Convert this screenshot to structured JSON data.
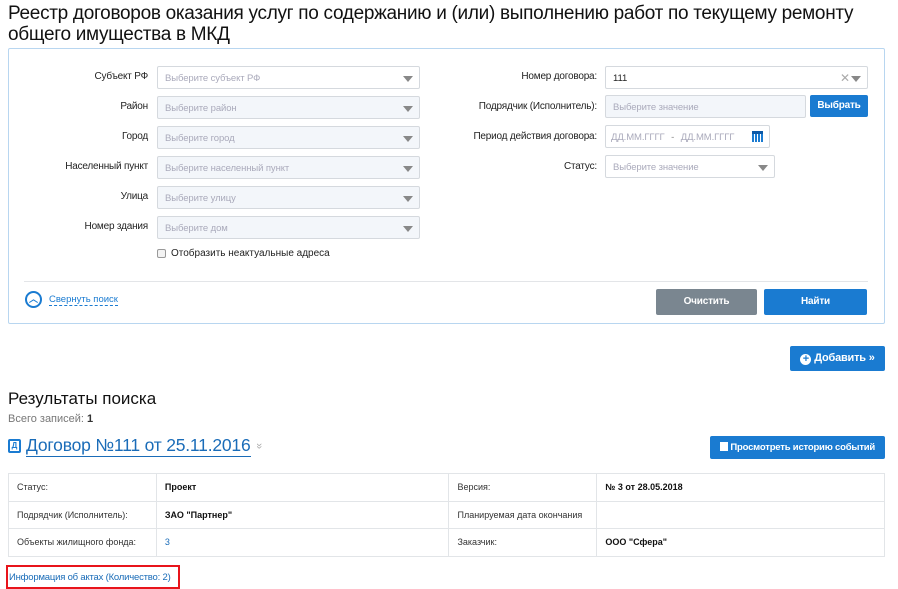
{
  "page_title": "Реестр договоров оказания услуг по содержанию и (или) выполнению работ по текущему ремонту общего имущества в МКД",
  "search": {
    "left_fields": [
      {
        "label": "Субъект РФ",
        "placeholder": "Выберите субъект РФ"
      },
      {
        "label": "Район",
        "placeholder": "Выберите район"
      },
      {
        "label": "Город",
        "placeholder": "Выберите город"
      },
      {
        "label": "Населенный пункт",
        "placeholder": "Выберите населенный пункт"
      },
      {
        "label": "Улица",
        "placeholder": "Выберите улицу"
      },
      {
        "label": "Номер здания",
        "placeholder": "Выберите дом"
      }
    ],
    "show_inactive_label": "Отобразить неактуальные адреса",
    "contract_number_label": "Номер договора:",
    "contract_number_value": "111",
    "contractor_label": "Подрядчик (Исполнитель):",
    "contractor_placeholder": "Выберите значение",
    "select_button": "Выбрать",
    "period_label": "Период действия договора:",
    "period_from_placeholder": "ДД.ММ.ГГГГ",
    "period_to_placeholder": "ДД.ММ.ГГГГ",
    "period_separator": "-",
    "status_label": "Статус:",
    "status_placeholder": "Выберите значение",
    "collapse_label": "Свернуть поиск",
    "clear_button": "Очистить",
    "find_button": "Найти"
  },
  "add_button": "Добавить",
  "results": {
    "title": "Результаты поиска",
    "total_label": "Всего записей:",
    "total_value": "1",
    "contract_title": "Договор №111 от 25.11.2016",
    "history_button": "Просмотреть историю событий",
    "rows": [
      [
        "Статус:",
        "Проект",
        "Версия:",
        "№ 3 от 28.05.2018"
      ],
      [
        "Подрядчик (Исполнитель):",
        "ЗАО \"Партнер\"",
        "Планируемая дата окончания",
        ""
      ],
      [
        "Объекты жилищного фонда:",
        "3",
        "Заказчик:",
        "ООО \"Сфера\""
      ]
    ],
    "acts_link": "Информация об актах (Количество: 2)"
  },
  "colors": {
    "accent": "#1a7bd1",
    "grey_button": "#7a8690",
    "highlight": "#e8141b"
  }
}
